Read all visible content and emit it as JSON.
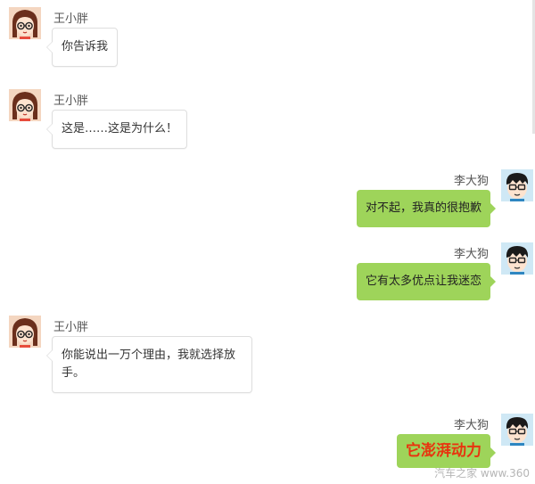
{
  "chat": {
    "participants": {
      "girl": "王小胖",
      "boy": "李大狗"
    },
    "messages": [
      {
        "side": "left",
        "sender": "王小胖",
        "text": "你告诉我"
      },
      {
        "side": "left",
        "sender": "王小胖",
        "text": "这是……这是为什么！"
      },
      {
        "side": "right",
        "sender": "李大狗",
        "text": "对不起，我真的很抱歉"
      },
      {
        "side": "right",
        "sender": "李大狗",
        "text": "它有太多优点让我迷恋"
      },
      {
        "side": "left",
        "sender": "王小胖",
        "text": "你能说出一万个理由，我就选择放手。"
      },
      {
        "side": "right",
        "sender": "李大狗",
        "text": "它澎湃动力",
        "emphasis": true
      }
    ]
  },
  "watermark": "汽车之家 www.360",
  "colors": {
    "outgoing_bubble": "#9ed45a",
    "incoming_bubble": "#ffffff",
    "emphasis_text": "#e8340f"
  },
  "icons": {
    "girl_avatar": "girl-with-glasses-avatar-icon",
    "boy_avatar": "boy-with-glasses-avatar-icon"
  }
}
